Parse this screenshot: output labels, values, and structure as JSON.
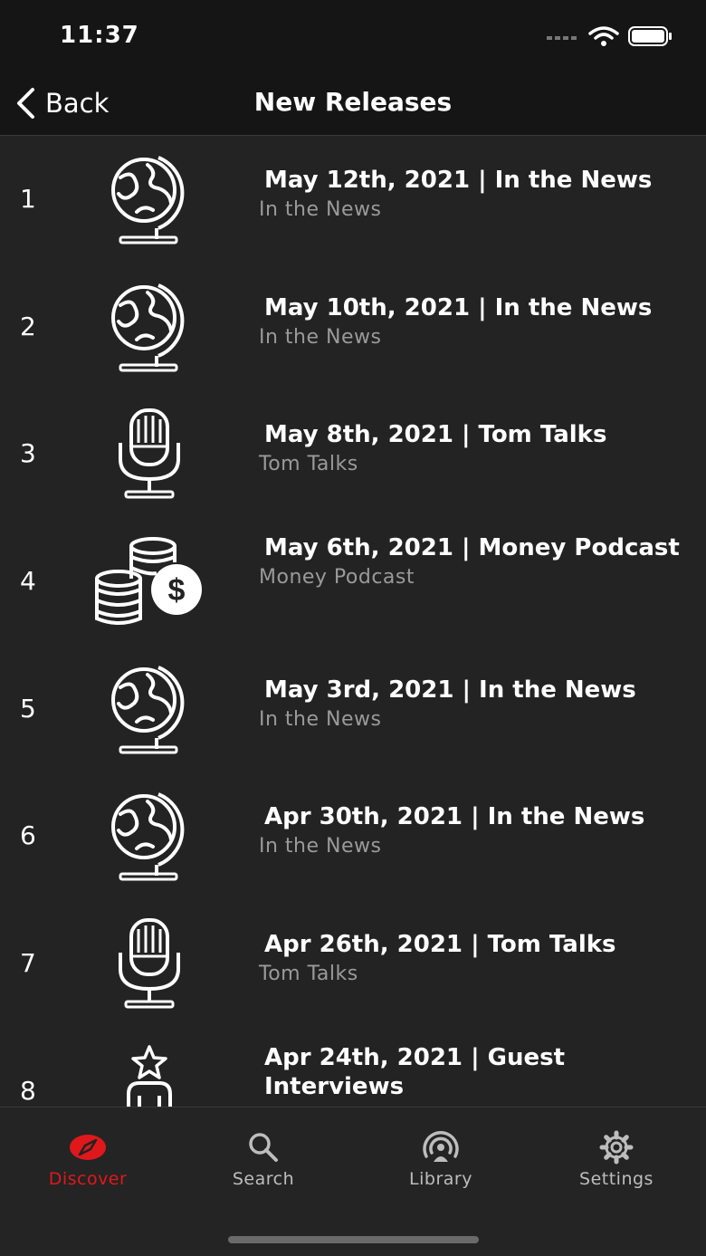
{
  "status": {
    "time": "11:37"
  },
  "nav": {
    "back_label": "Back",
    "title": "New Releases"
  },
  "episodes": [
    {
      "rank": "1",
      "title": "May 12th, 2021 | In the News",
      "show": "In the News",
      "icon": "globe-icon"
    },
    {
      "rank": "2",
      "title": "May 10th, 2021 | In the News",
      "show": "In the News",
      "icon": "globe-icon"
    },
    {
      "rank": "3",
      "title": "May 8th, 2021 | Tom Talks",
      "show": "Tom Talks",
      "icon": "microphone-icon"
    },
    {
      "rank": "4",
      "title": "May 6th, 2021 | Money Podcast",
      "show": "Money Podcast",
      "icon": "coins-dollar-icon"
    },
    {
      "rank": "5",
      "title": "May 3rd, 2021 | In the News",
      "show": "In the News",
      "icon": "globe-icon"
    },
    {
      "rank": "6",
      "title": "Apr 30th, 2021 | In the News",
      "show": "In the News",
      "icon": "globe-icon"
    },
    {
      "rank": "7",
      "title": "Apr 26th, 2021 | Tom Talks",
      "show": "Tom Talks",
      "icon": "microphone-icon"
    },
    {
      "rank": "8",
      "title": "Apr 24th, 2021 | Guest Interviews",
      "show": "",
      "icon": "person-star-icon"
    }
  ],
  "tabs": [
    {
      "label": "Discover",
      "icon": "compass-icon",
      "active": true
    },
    {
      "label": "Search",
      "icon": "search-icon",
      "active": false
    },
    {
      "label": "Library",
      "icon": "podcast-icon",
      "active": false
    },
    {
      "label": "Settings",
      "icon": "gear-icon",
      "active": false
    }
  ],
  "colors": {
    "accent": "#e0181b",
    "background": "#232323",
    "bar": "#151515",
    "subtitle": "#9a9a9a"
  }
}
